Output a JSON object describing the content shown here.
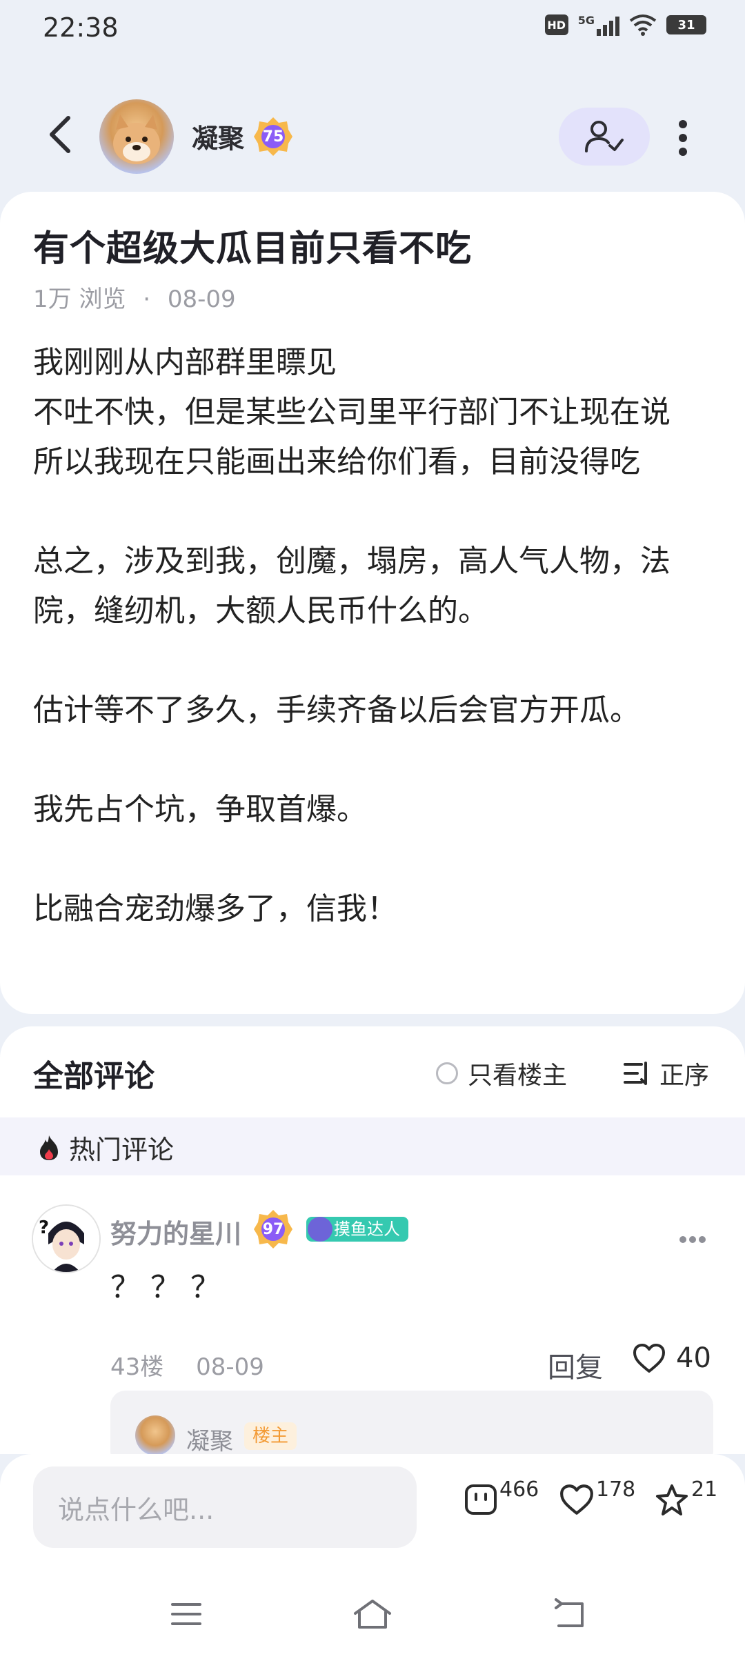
{
  "status_bar": {
    "time": "22:38",
    "hd": "HD",
    "network": "5G",
    "battery": "31"
  },
  "nav": {
    "author_name": "凝聚",
    "author_level": "75",
    "icons": {
      "back": "chevron-left-icon",
      "follow": "user-check-icon",
      "more": "more-vertical-icon"
    }
  },
  "post": {
    "title": "有个超级大瓜目前只看不吃",
    "views": "1万 浏览",
    "dot": "·",
    "date": "08-09",
    "body": "我刚刚从内部群里瞟见\n不吐不快，但是某些公司里平行部门不让现在说\n所以我现在只能画出来给你们看，目前没得吃\n\n总之，涉及到我，创魔，塌房，高人气人物，法院，缝纫机，大额人民币什么的。\n\n估计等不了多久，手续齐备以后会官方开瓜。\n\n我先占个坑，争取首爆。\n\n比融合宠劲爆多了，信我！"
  },
  "comments": {
    "title": "全部评论",
    "only_op_label": "只看楼主",
    "sort_label": "正序",
    "hot_label": "热门评论",
    "items": [
      {
        "name": "努力的星川",
        "level": "97",
        "tag": "摸鱼达人",
        "text": "？？？",
        "floor": "43楼",
        "date": "08-09",
        "reply_label": "回复",
        "likes": "40",
        "reply_preview": {
          "name": "凝聚",
          "badge": "楼主"
        }
      }
    ]
  },
  "bottom": {
    "input_placeholder": "说点什么吧...",
    "comments_count": "466",
    "likes_count": "178",
    "favorites_count": "21"
  },
  "colors": {
    "accent": "#e3e2fb",
    "level_badge": "#8b5cf6",
    "tag": "#35c9b0",
    "op_badge": "#f39a34"
  }
}
